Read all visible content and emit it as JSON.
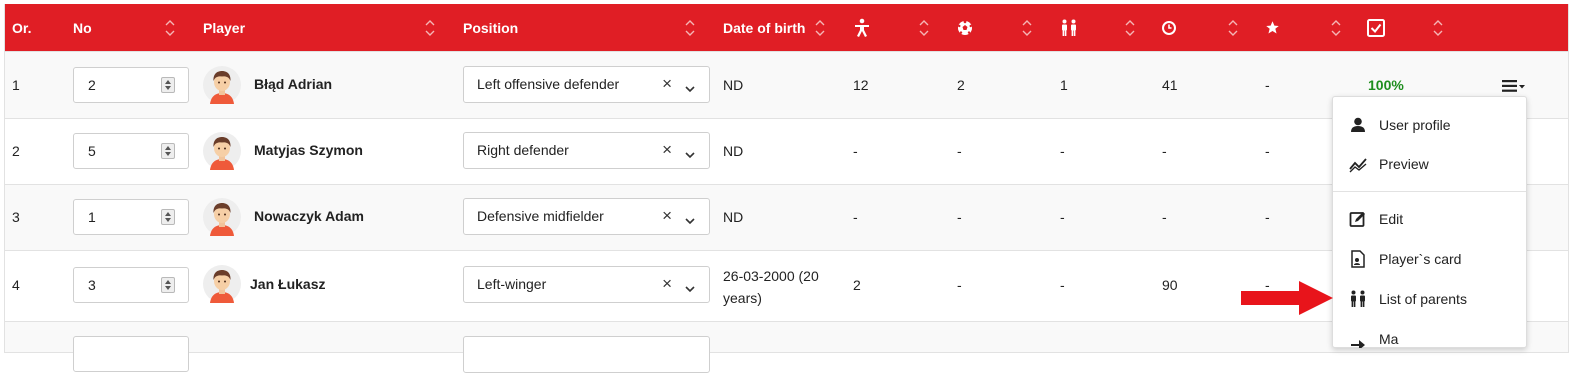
{
  "header": {
    "order": "Or.",
    "no": "No",
    "player": "Player",
    "position": "Position",
    "dob": "Date of birth",
    "icons": [
      "running-person-icon",
      "football-icon",
      "people-icon",
      "clock-icon",
      "star-icon",
      "checkbox-icon"
    ]
  },
  "rows": [
    {
      "order": "1",
      "no": "2",
      "player": "Błąd Adrian",
      "position": "Left offensive defender",
      "dob": "ND",
      "stat1": "12",
      "stat2": "2",
      "stat3": "1",
      "stat4": "41",
      "stat5": "-",
      "attendance": "100%"
    },
    {
      "order": "2",
      "no": "5",
      "player": "Matyjas Szymon",
      "position": "Right defender",
      "dob": "ND",
      "stat1": "-",
      "stat2": "-",
      "stat3": "-",
      "stat4": "-",
      "stat5": "-"
    },
    {
      "order": "3",
      "no": "1",
      "player": "Nowaczyk Adam",
      "position": "Defensive midfielder",
      "dob": "ND",
      "stat1": "-",
      "stat2": "-",
      "stat3": "-",
      "stat4": "-",
      "stat5": "-"
    },
    {
      "order": "4",
      "no": "3",
      "player": "Jan Łukasz",
      "position": "Left-winger",
      "dob": "26-03-2000 (20 years)",
      "stat1": "2",
      "stat2": "-",
      "stat3": "-",
      "stat4": "90",
      "stat5": "-"
    }
  ],
  "select_clear": "×",
  "menu": {
    "items": [
      {
        "label": "User profile",
        "icon": "user-icon"
      },
      {
        "label": "Preview",
        "icon": "chart-line-icon"
      },
      {
        "label": "Edit",
        "icon": "edit-icon"
      },
      {
        "label": "Player`s card",
        "icon": "document-icon"
      },
      {
        "label": "List of parents",
        "icon": "parents-icon"
      },
      {
        "label": "Ma",
        "icon": "arrow-icon"
      }
    ]
  },
  "colors": {
    "header_bg": "#e01e25",
    "success": "#1e8e1e",
    "annotation_arrow": "#e8141b"
  }
}
